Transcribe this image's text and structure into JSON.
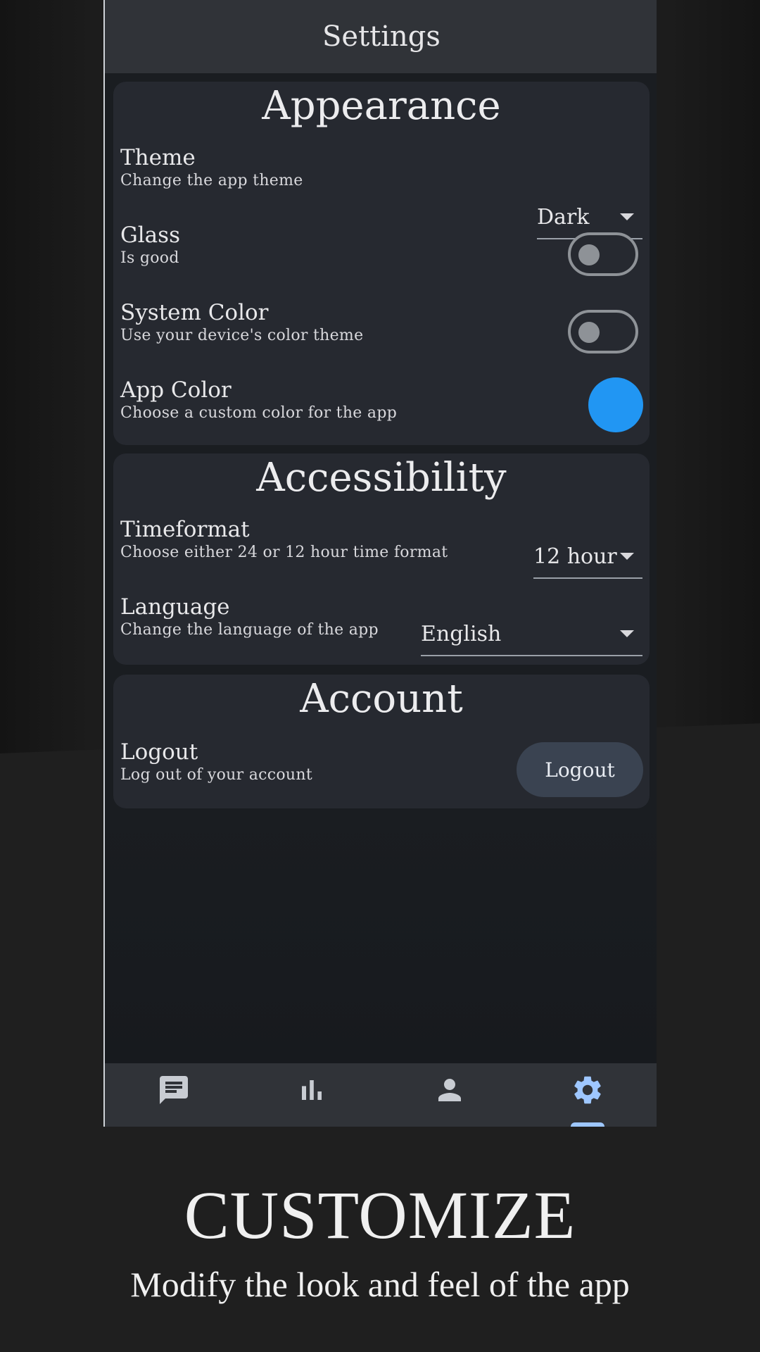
{
  "app": {
    "title": "Settings"
  },
  "appearance": {
    "title": "Appearance",
    "theme": {
      "label": "Theme",
      "description": "Change the app theme",
      "value": "Dark"
    },
    "glass": {
      "label": "Glass",
      "description": "Is good",
      "enabled": false
    },
    "system_color": {
      "label": "System Color",
      "description": "Use your device's color theme",
      "enabled": false
    },
    "app_color": {
      "label": "App Color",
      "description": "Choose a custom color for the app",
      "color": "#2196f3"
    }
  },
  "accessibility": {
    "title": "Accessibility",
    "timeformat": {
      "label": "Timeformat",
      "description": "Choose either 24 or 12 hour time format",
      "value": "12 hour"
    },
    "language": {
      "label": "Language",
      "description": "Change the language of the app",
      "value": "English"
    }
  },
  "account": {
    "title": "Account",
    "logout": {
      "label": "Logout",
      "description": "Log out of your account",
      "button_label": "Logout"
    }
  },
  "nav": {
    "items": [
      {
        "icon": "chat-icon",
        "selected": false
      },
      {
        "icon": "bar-chart-icon",
        "selected": false
      },
      {
        "icon": "person-icon",
        "selected": false
      },
      {
        "icon": "gear-icon",
        "selected": true
      }
    ],
    "accent": "#9ec7ff"
  },
  "caption": {
    "title": "CUSTOMIZE",
    "subtitle": "Modify the look and feel of the app"
  }
}
